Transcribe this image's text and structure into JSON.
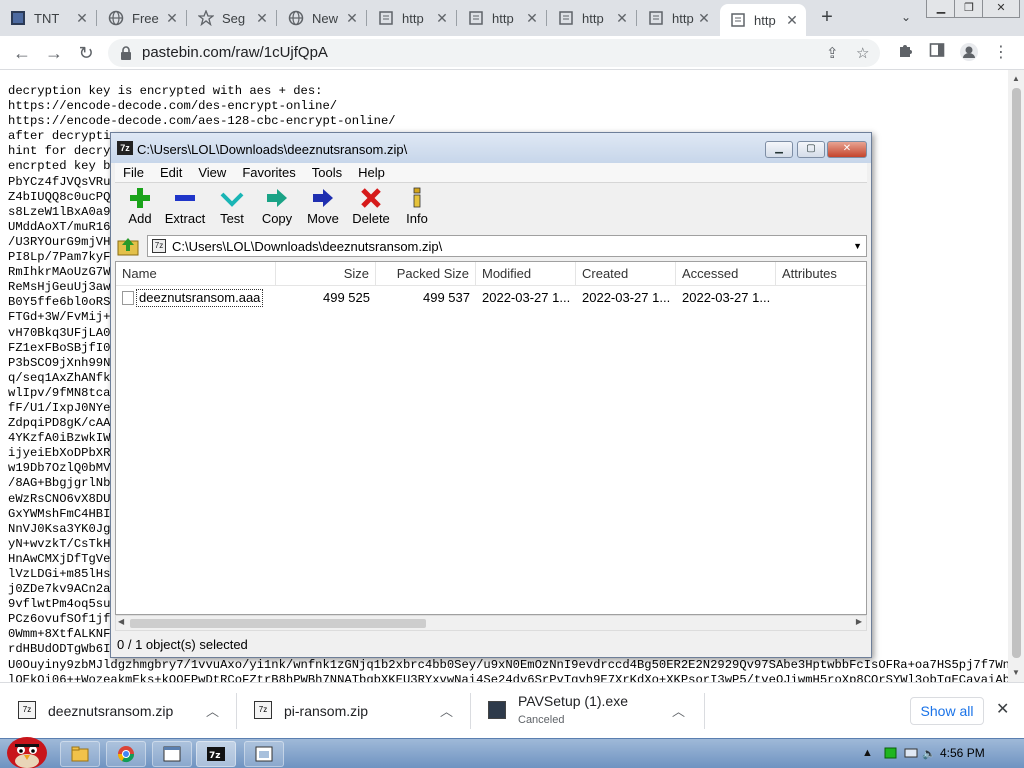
{
  "browser": {
    "tabs": [
      {
        "label": "TNT",
        "icon": "tnt-icon"
      },
      {
        "label": "Free",
        "icon": "globe-icon"
      },
      {
        "label": "Seg",
        "icon": "puzzle-icon"
      },
      {
        "label": "New",
        "icon": "globe-icon"
      },
      {
        "label": "http",
        "icon": "page-icon"
      },
      {
        "label": "http",
        "icon": "page-icon"
      },
      {
        "label": "http",
        "icon": "page-icon"
      },
      {
        "label": "http",
        "icon": "page-icon"
      },
      {
        "label": "http",
        "icon": "page-icon",
        "active": true
      }
    ],
    "url": "pastebin.com/raw/1cUjfQpA"
  },
  "page": {
    "lines": [
      "decryption key is encrypted with aes + des:",
      "https://encode-decode.com/des-encrypt-online/",
      "https://encode-decode.com/aes-128-cbc-encrypt-online/",
      "after decrypti",
      "hint for decry",
      "encrpted key b",
      "PbYCz4fJVQsVRu                                                                           pCTH6Cw5FVCeXDyCH",
      "Z4bIUQQ8c0ucPQ                                                                           /8PfEskAnUanI07MG",
      "s8LzeW1lBxA0a9                                                                           t613FNJjj6cHS0S7O",
      "UMddAoXT/muR16                                                                           /DDHTAPXc/86iwKx",
      "/U3RYOurG9mjVH                                                                           4K+hQYICuIhG8gOy0",
      "PI8Lp/7Pam7kyF                                                                           3wwMCingBvy1HS8J2",
      "RmIhkrMAoUzG7W                                                                           L9S1VNxDA+gr034YD",
      "ReMsHjGeuUj3aw                                                                           B5NIUKNUWmIfd0Yo5",
      "B0Y5ffe6bl0oRS                                                                           5MUo/AoRpp/51Q72F",
      "FTGd+3W/FvMij+                                                                           mGqZ+xXDZxYdBFrFUk",
      "vH70Bkq3UFjLA0                                                                           CgSc4hyqWAcjBRXE4",
      "FZ1exFBoSBjfI0                                                                           FL6A5rnC6uE+OQ7om",
      "P3bSCO9jXnh99N                                                                           Y09KGk9s8oYWjWjXt",
      "q/seq1AxZhANfk                                                                           TBsQWYSIPUauSP78i",
      "wlIpv/9fMN8tca                                                                           v9ztNXfd3HgLOFCT9",
      "fF/U1/IxpJ0NYe                                                                           3mFazQ+/hlQGZR87K",
      "ZdpqiPD8gK/cAA                                                                           Gk7vJTXwqoYfTsaIe",
      "4YKzfA0iBzwkIW                                                                           ePKS1QQ607WupvEmg",
      "ijyeiEbXoDPbXR                                                                           L6uCK3gsFGmeXP2Gd",
      "w19Db7OzlQ0bMV                                                                           YvIRACuYwi7gUyslr",
      "/8AG+BbgjgrlNb                                                                           FfR+9W+ZP5DkwJ6KT",
      "eWzRsCNO6vX8DU                                                                           nUqT/G2IBmS8Gt7gm",
      "GxYWMshFmC4HBI                                                                           /yogOuQ/Pn+q30d4A",
      "NnVJ0Ksa3YK0Jg                                                                           dwmzFbn7QkN8PhFSo",
      "yN+wvzkT/CsTkH                                                                           5AUutjTUSXjtqOraV",
      "HnAwCMXjDfTgVe                                                                           fjZMIHUBFD81gK0gk",
      "lVzLDGi+m85lHsy                                                                          XGVRs6egbBFhTVqeh",
      "j0ZDe7kv9ACn2a                                                                           Gwu+NAfIVJNL+fgjU",
      "9vflwtPm4oq5su                                                                           oWF3waM+7K2/ArGtF",
      "PCz6ovufSOf1jf                                                                           VvAqtSaFp5cnmTHK3",
      "0Wmm+8XtfALKNF                                                                           ldqdYBM+XbpWoRKYQ",
      "rdHBUdODTgWb6I                                                                           ssCXRWpXnYMpPcard",
      "U0Ouyiny9zbMJldgzhmgbry7/1vvuAxo/yi1nk/wnfnk1zGNjq1b2xbrc4bb0Sey/u9xN0EmOzNnI9evdrccd4Bg50ER2E2N2929Qv97SAbe3HptwbbFcIsOFRa+oa7HS5pj7f7Wnf",
      "lOEkOi06++WozeakmEks+kOOFPwDtRCoFZtrB8hPWBh7NNATbgbXKEU3RYxvwNai4Se24dv6SrPvTgvh9E7XrKdXo+XKPsorI3wP5/tveOJiwmH5roXp8COrSYWl3obTqECavaiAbM"
    ]
  },
  "zip": {
    "title": "C:\\Users\\LOL\\Downloads\\deeznutsransom.zip\\",
    "menu": [
      "File",
      "Edit",
      "View",
      "Favorites",
      "Tools",
      "Help"
    ],
    "toolbar": [
      "Add",
      "Extract",
      "Test",
      "Copy",
      "Move",
      "Delete",
      "Info"
    ],
    "address": "C:\\Users\\LOL\\Downloads\\deeznutsransom.zip\\",
    "columns": [
      "Name",
      "Size",
      "Packed Size",
      "Modified",
      "Created",
      "Accessed",
      "Attributes"
    ],
    "file": {
      "name": "deeznutsransom.aaa",
      "size": "499 525",
      "packed": "499 537",
      "modified": "2022-03-27 1...",
      "created": "2022-03-27 1...",
      "accessed": "2022-03-27 1..."
    },
    "status": "0 / 1 object(s) selected"
  },
  "downloads": {
    "items": [
      {
        "name": "deeznutsransom.zip",
        "sub": ""
      },
      {
        "name": "pi-ransom.zip",
        "sub": ""
      },
      {
        "name": "PAVSetup (1).exe",
        "sub": "Canceled"
      }
    ],
    "show_all": "Show all"
  },
  "taskbar": {
    "time": "4:56 PM"
  }
}
